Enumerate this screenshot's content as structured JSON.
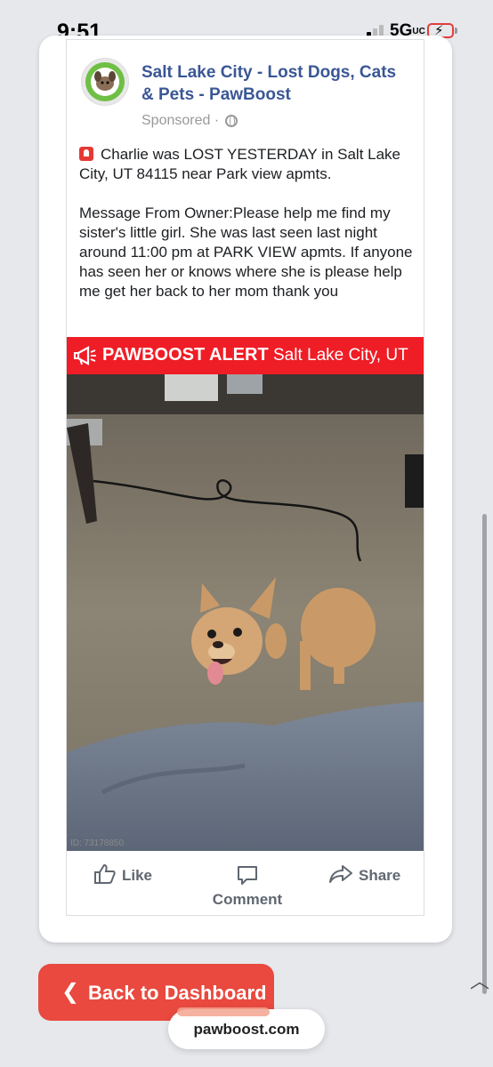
{
  "status_bar": {
    "time": "9:51",
    "network": "5G",
    "network_suffix": "UC"
  },
  "post": {
    "page_name": "Salt Lake City - Lost Dogs, Cats & Pets - PawBoost",
    "sponsored": "Sponsored ·",
    "line1": "Charlie was LOST YESTERDAY in Salt Lake City, UT 84115 near Park view apmts.",
    "line2": "Message From Owner:Please help me find my sister's little girl. She was last seen last night around 11:00 pm at PARK VIEW apmts. If anyone has seen her or knows where she is please help me get her back to her mom thank you",
    "alert_title": "PAWBOOST ALERT",
    "alert_location": "Salt Lake City, UT",
    "photo_id": "ID: 73178850",
    "actions": {
      "like": "Like",
      "comment": "Comment",
      "share": "Share"
    }
  },
  "back_button": "Back to Dashboard",
  "url": "pawboost.com",
  "colors": {
    "accent": "#e9493f",
    "alert": "#ef1d26",
    "link": "#3a5795"
  }
}
